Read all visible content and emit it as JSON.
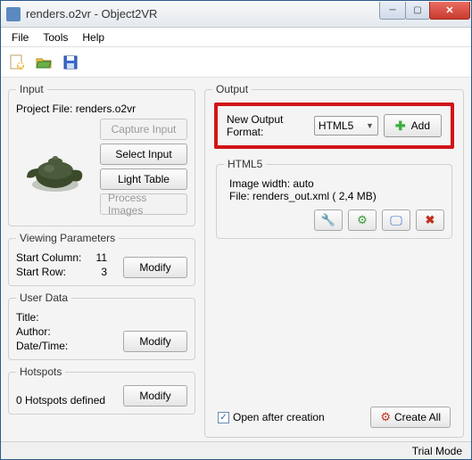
{
  "window": {
    "title": "renders.o2vr  - Object2VR"
  },
  "menu": {
    "file": "File",
    "tools": "Tools",
    "help": "Help"
  },
  "input": {
    "legend": "Input",
    "project_label": "Project File:",
    "project_value": "renders.o2vr",
    "capture": "Capture Input",
    "select": "Select Input",
    "light_table": "Light Table",
    "process": "Process Images"
  },
  "viewing": {
    "legend": "Viewing Parameters",
    "start_col_label": "Start Column:",
    "start_col_value": "11",
    "start_row_label": "Start Row:",
    "start_row_value": "3",
    "modify": "Modify"
  },
  "userdata": {
    "legend": "User Data",
    "title_label": "Title:",
    "author_label": "Author:",
    "date_label": "Date/Time:",
    "modify": "Modify"
  },
  "hotspots": {
    "legend": "Hotspots",
    "text": "0 Hotspots defined",
    "modify": "Modify"
  },
  "output": {
    "legend": "Output",
    "new_format_label": "New Output Format:",
    "format_value": "HTML5",
    "add": "Add",
    "html5": {
      "legend": "HTML5",
      "image_width": "Image width: auto",
      "file_line": "File: renders_out.xml (       2,4 MB)"
    },
    "open_after": "Open after creation",
    "create_all": "Create All"
  },
  "status": {
    "trial": "Trial Mode"
  }
}
